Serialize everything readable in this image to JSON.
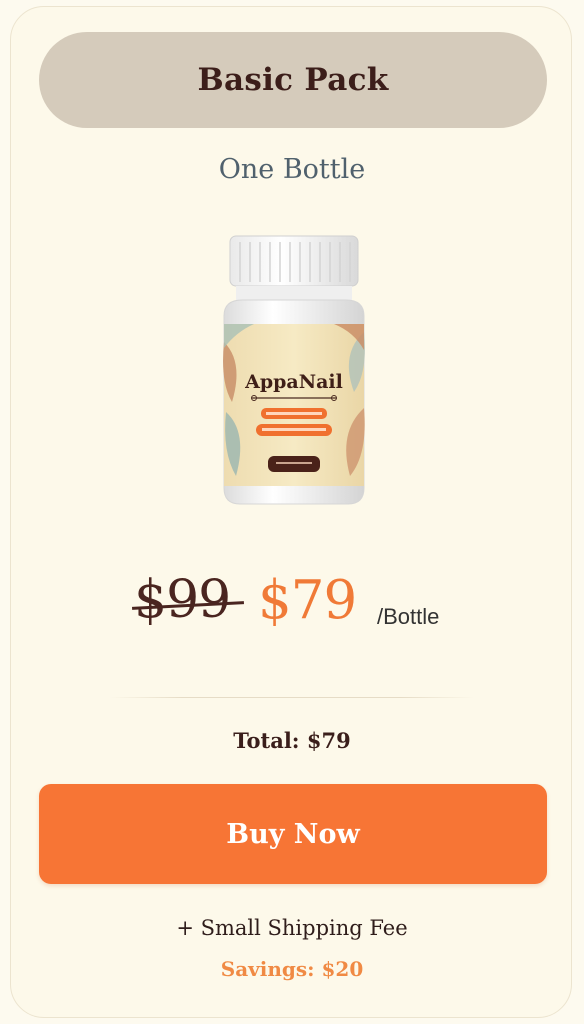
{
  "offer": {
    "pack_name": "Basic Pack",
    "quantity_label": "One Bottle"
  },
  "product": {
    "brand": "AppaNail",
    "image_icon": "supplement-bottle-icon"
  },
  "pricing": {
    "original_price": "$99",
    "sale_price": "$79",
    "unit": "/Bottle",
    "total": "Total: $79"
  },
  "cta": {
    "buy_label": "Buy Now"
  },
  "footer": {
    "shipping_note": "+ Small Shipping Fee",
    "savings": "Savings: $20"
  },
  "colors": {
    "accent": "#f77535",
    "pill": "#d5cbbb",
    "background": "#fdf9ea",
    "savings_text": "#f08a44",
    "dark_text": "#3c1e1a"
  }
}
